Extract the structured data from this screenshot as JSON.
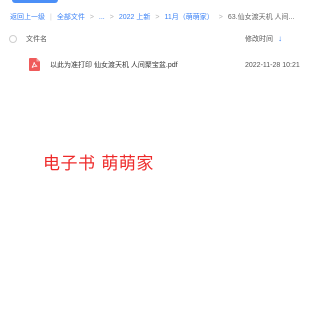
{
  "breadcrumb": {
    "back": "返回上一级",
    "items": [
      "全部文件",
      "...",
      "2022 上新",
      "11月（萌萌家）",
      "63.仙女渡天机 人间..."
    ]
  },
  "table": {
    "header": {
      "name": "文件名",
      "modified": "修改时间"
    },
    "rows": [
      {
        "icon": "pdf-icon",
        "name": "以此为准打印 仙女渡天机 人间聚宝盆.pdf",
        "modified": "2022-11-28 10:21"
      }
    ]
  },
  "watermark": "电子书 萌萌家",
  "colors": {
    "accent": "#3b82f6",
    "pdf": "#ef5b5b",
    "watermark": "#ee2a2a"
  }
}
